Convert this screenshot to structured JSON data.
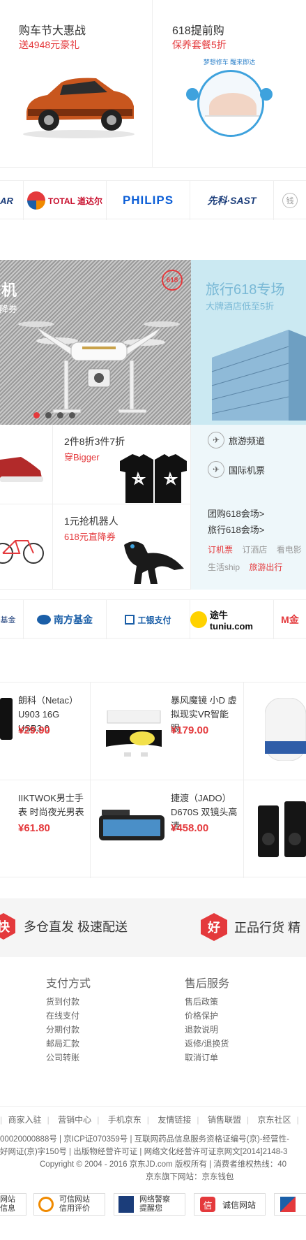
{
  "promos": [
    {
      "title": "购车节大惠战",
      "subtitle": "送4948元豪礼"
    },
    {
      "title": "618提前购",
      "subtitle": "保养套餐5折",
      "graphic_caption": "梦想修车 醒来即达"
    }
  ],
  "brands_row1": [
    "AR",
    "TOTAL 道达尔",
    "PHILIPS",
    "先科·SAST",
    "钱"
  ],
  "hero": {
    "title_fragment": "机",
    "subtitle_fragment": "直降券",
    "badge": "618",
    "dots": 4,
    "active_dot": 0
  },
  "travel": {
    "title": "旅行618专场",
    "subtitle": "大牌酒店低至5折"
  },
  "deals": [
    {
      "title": "2件8折3件7折",
      "subtitle": "穿Bigger"
    },
    {
      "title": "1元抢机器人",
      "subtitle": "618元直降券"
    }
  ],
  "travel_links": [
    {
      "label": "旅游频道",
      "icon": "plane-icon"
    },
    {
      "label": "国际机票",
      "icon": "plane-icon"
    }
  ],
  "travel_promos": [
    "团购618会场>",
    "旅行618会场>"
  ],
  "travel_tabs_row1": [
    "订机票",
    "订酒店",
    "看电影"
  ],
  "travel_tabs_row2": [
    "生活ship",
    "旅游出行"
  ],
  "brands_row2": [
    "基金",
    "南方基金",
    "工银支付",
    "途牛 tuniu.com",
    "M金"
  ],
  "products": [
    {
      "name": "朗科（Netac）U903 16G USB3.0",
      "price": "¥29.90"
    },
    {
      "name": "暴风魔镜 小D 虚拟现实VR智能眼",
      "price": "¥179.00"
    },
    {
      "name": "IIKTWOK男士手表 时尚夜光男表",
      "price": "¥61.80"
    },
    {
      "name": "捷渡（JADO）D670S 双镜头高清",
      "price": "¥458.00"
    }
  ],
  "services": [
    {
      "icon_char": "快",
      "label": "多仓直发 极速配送"
    },
    {
      "icon_char": "好",
      "label": "正品行货 精"
    }
  ],
  "footer_cols": [
    {
      "title": "支付方式",
      "links": [
        "货到付款",
        "在线支付",
        "分期付款",
        "邮局汇款",
        "公司转账"
      ]
    },
    {
      "title": "售后服务",
      "links": [
        "售后政策",
        "价格保护",
        "退款说明",
        "返修/退换货",
        "取消订单"
      ]
    }
  ],
  "footer_nav": [
    "商家入驻",
    "营销中心",
    "手机京东",
    "友情链接",
    "销售联盟",
    "京东社区"
  ],
  "legal_lines": [
    "00020000888号 | 京ICP证070359号 | 互联网药品信息服务资格证编号(京)-经营性-",
    "好网证(京)字150号 | 出版物经营许可证 | 网络文化经营许可证京网文[2014]2148-3",
    "Copyright © 2004 - 2016  京东JD.com 版权所有 | 消费者维权热线：40",
    "京东旗下网站：京东钱包"
  ],
  "trust_badges": [
    {
      "line1": "网站",
      "line2": "信息"
    },
    {
      "line1": "可信网站",
      "line2": "信用评价"
    },
    {
      "line1": "网络警察",
      "line2": "提醒您"
    },
    {
      "line1": "诚信网站",
      "line2": ""
    }
  ],
  "colors": {
    "accent": "#e4393c",
    "travel_bg": "#cbe9f2",
    "travel_text": "#7ab9d6"
  }
}
